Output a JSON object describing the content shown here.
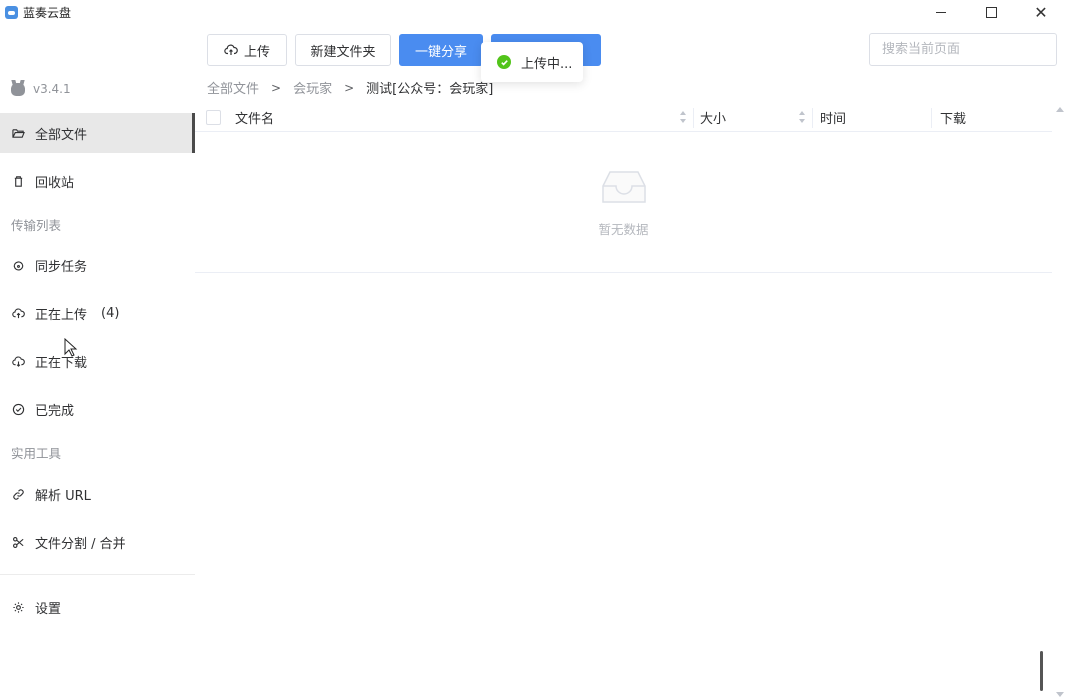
{
  "window": {
    "title": "蓝奏云盘",
    "controls": {
      "minimize": "minimize-icon",
      "maximize": "maximize-icon",
      "close": "✕"
    }
  },
  "sidebar": {
    "version": "v3.4.1",
    "items": [
      {
        "label": "全部文件",
        "icon": "folder-open-icon",
        "active": true
      },
      {
        "label": "回收站",
        "icon": "trash-icon"
      }
    ],
    "sections": [
      {
        "label": "传输列表",
        "items": [
          {
            "label": "同步任务",
            "icon": "sync-icon"
          },
          {
            "label": "正在上传",
            "icon": "cloud-upload-icon",
            "count": "(4)"
          },
          {
            "label": "正在下载",
            "icon": "cloud-download-icon"
          },
          {
            "label": "已完成",
            "icon": "check-circle-icon"
          }
        ]
      },
      {
        "label": "实用工具",
        "items": [
          {
            "label": "解析 URL",
            "icon": "link-icon"
          },
          {
            "label": "文件分割 / 合并",
            "icon": "scissors-icon"
          }
        ]
      }
    ],
    "settings": {
      "label": "设置",
      "icon": "gear-icon"
    }
  },
  "toolbar": {
    "upload_label": "上传",
    "new_folder_label": "新建文件夹",
    "share_label": "一键分享",
    "search_placeholder": "搜索当前页面"
  },
  "toast": {
    "message": "上传中..."
  },
  "breadcrumb": [
    "全部文件",
    "会玩家",
    "测试[公众号：会玩家]"
  ],
  "table": {
    "columns": [
      "文件名",
      "大小",
      "时间",
      "下载"
    ],
    "rows": [],
    "empty_text": "暂无数据"
  },
  "colors": {
    "primary": "#4a8cf0",
    "success": "#52c41a",
    "active_bg": "#e8e8e8"
  }
}
